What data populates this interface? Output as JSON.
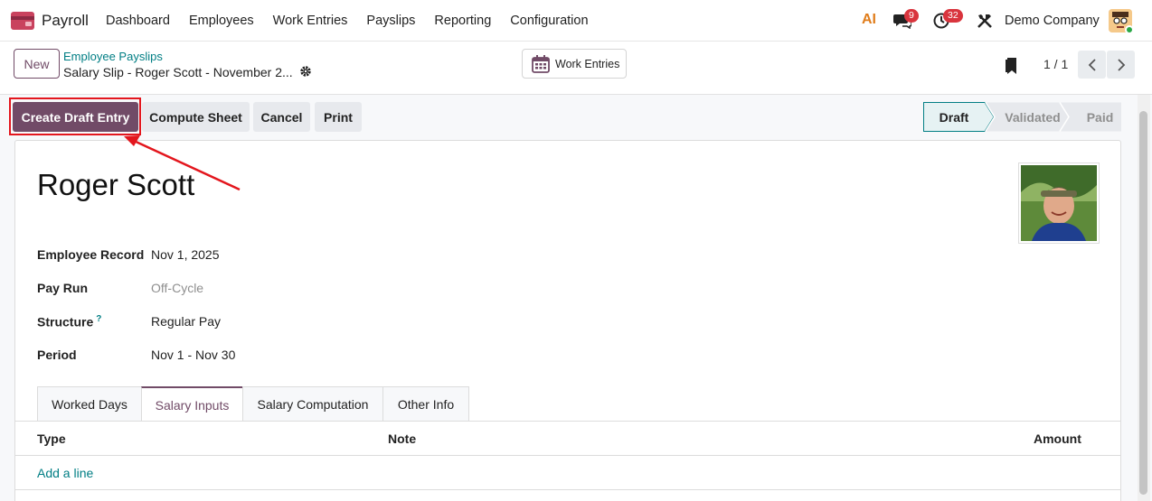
{
  "navbar": {
    "app_name": "Payroll",
    "menu": [
      "Dashboard",
      "Employees",
      "Work Entries",
      "Payslips",
      "Reporting",
      "Configuration"
    ],
    "ai_label": "AI",
    "messages_count": "9",
    "activities_count": "32",
    "company": "Demo Company"
  },
  "control": {
    "new_label": "New",
    "breadcrumb": "Employee Payslips",
    "record_title": "Salary Slip - Roger Scott - November 2...",
    "work_entries_label": "Work Entries",
    "pager": "1 / 1"
  },
  "actions": {
    "create_draft": "Create Draft Entry",
    "compute_sheet": "Compute Sheet",
    "cancel": "Cancel",
    "print": "Print"
  },
  "status": {
    "stages": [
      "Draft",
      "Validated",
      "Paid"
    ],
    "current": "Draft"
  },
  "form": {
    "employee_name": "Roger Scott",
    "fields": [
      {
        "label": "Employee Record",
        "value": "Nov 1, 2025"
      },
      {
        "label": "Pay Run",
        "value": "Off-Cycle"
      },
      {
        "label": "Structure",
        "value": "Regular Pay",
        "help": "?"
      },
      {
        "label": "Period",
        "value": "Nov 1 - Nov 30"
      }
    ],
    "tabs": [
      "Worked Days",
      "Salary Inputs",
      "Salary Computation",
      "Other Info"
    ],
    "active_tab": "Salary Inputs",
    "columns": [
      "Type",
      "Note",
      "Amount"
    ],
    "add_line": "Add a line"
  },
  "colors": {
    "primary": "#714b67",
    "link": "#017e84",
    "annotation": "#e3161d"
  }
}
